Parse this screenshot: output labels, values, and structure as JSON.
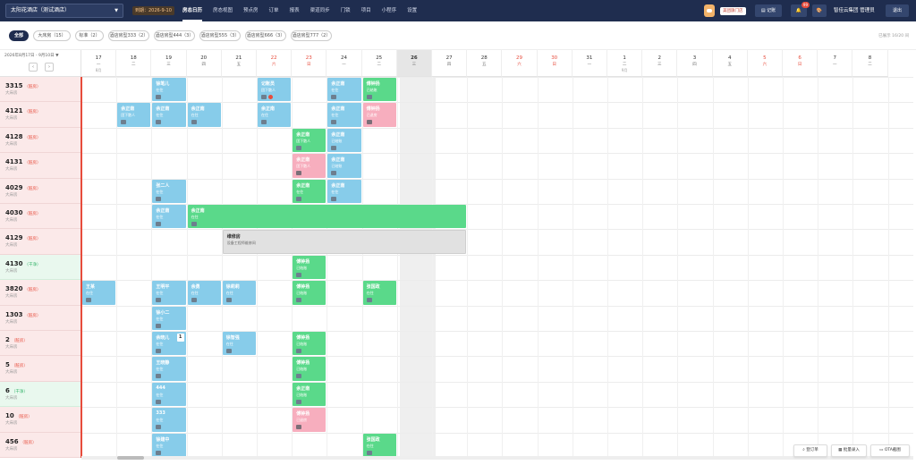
{
  "topbar": {
    "hotel": "太阳花酒店（测试酒店）",
    "expire": "到期：2026-9-10",
    "nav": [
      "房态日历",
      "房态视图",
      "预点房",
      "订单",
      "报表",
      "渠道同步",
      "门锁",
      "项目",
      "小程序",
      "设置"
    ],
    "store_label": "美团旗门店",
    "note_label": "记账",
    "bell_badge": "99",
    "user": "智佳云集团 管理员",
    "logout": "退出"
  },
  "filters": [
    "全部",
    "大床房（15）",
    "标准（2）",
    "酒店房型333（2）",
    "酒店房型444（3）",
    "酒店房型555（3）",
    "酒店房型666（3）",
    "酒店房型777（2）"
  ],
  "shown_count": "已展示 16/20 间",
  "date_range": "2026年8月17日 - 9月10日",
  "days": [
    {
      "d": "17",
      "w": "一",
      "m": "8月"
    },
    {
      "d": "18",
      "w": "二"
    },
    {
      "d": "19",
      "w": "三"
    },
    {
      "d": "20",
      "w": "四"
    },
    {
      "d": "21",
      "w": "五"
    },
    {
      "d": "22",
      "w": "六",
      "we": 1
    },
    {
      "d": "23",
      "w": "日",
      "we": 1
    },
    {
      "d": "24",
      "w": "一"
    },
    {
      "d": "25",
      "w": "二"
    },
    {
      "d": "26",
      "w": "三",
      "today": 1
    },
    {
      "d": "27",
      "w": "四"
    },
    {
      "d": "28",
      "w": "五"
    },
    {
      "d": "29",
      "w": "六",
      "we": 1
    },
    {
      "d": "30",
      "w": "日",
      "we": 1
    },
    {
      "d": "31",
      "w": "一"
    },
    {
      "d": "1",
      "w": "二",
      "m": "9月"
    },
    {
      "d": "2",
      "w": "三"
    },
    {
      "d": "3",
      "w": "四"
    },
    {
      "d": "4",
      "w": "五"
    },
    {
      "d": "5",
      "w": "六",
      "we": 1
    },
    {
      "d": "6",
      "w": "日",
      "we": 1
    },
    {
      "d": "7",
      "w": "一"
    },
    {
      "d": "8",
      "w": "二"
    }
  ],
  "rooms": [
    {
      "no": "3315",
      "status": "（脏房）",
      "type": "大床房"
    },
    {
      "no": "4121",
      "status": "（脏房）",
      "type": "大床房"
    },
    {
      "no": "4128",
      "status": "（脏房）",
      "type": "大床房"
    },
    {
      "no": "4131",
      "status": "（脏房）",
      "type": "大床房"
    },
    {
      "no": "4029",
      "status": "（脏房）",
      "type": "大床房"
    },
    {
      "no": "4030",
      "status": "（脏房）",
      "type": "大床房"
    },
    {
      "no": "4129",
      "status": "（脏房）",
      "type": "大床房"
    },
    {
      "no": "4130",
      "status": "（干净）",
      "type": "大床房",
      "free": 1
    },
    {
      "no": "3820",
      "status": "（脏房）",
      "type": "大床房"
    },
    {
      "no": "1303",
      "status": "（脏房）",
      "type": "大床房"
    },
    {
      "no": "2",
      "status": "（脏房）",
      "type": "大床房"
    },
    {
      "no": "5",
      "status": "（脏房）",
      "type": "大床房"
    },
    {
      "no": "6",
      "status": "（干净）",
      "type": "大床房",
      "free": 1
    },
    {
      "no": "10",
      "status": "（脏房）",
      "type": "大床房"
    },
    {
      "no": "456",
      "status": "（脏房）",
      "type": "大床房"
    }
  ],
  "bookings": [
    {
      "r": 0,
      "c": 2,
      "s": 1,
      "color": "blue",
      "name": "徐笔儿",
      "sub": "在住"
    },
    {
      "r": 0,
      "c": 5,
      "s": 1,
      "color": "blue",
      "name": "记账员",
      "sub": "团下散人",
      "flag": 1
    },
    {
      "r": 0,
      "c": 7,
      "s": 1,
      "color": "blue",
      "name": "余正南",
      "sub": "在住"
    },
    {
      "r": 0,
      "c": 8,
      "s": 1,
      "color": "green",
      "name": "傅钟扬",
      "sub": "已结账"
    },
    {
      "r": 1,
      "c": 1,
      "s": 1,
      "color": "blue",
      "name": "余正南",
      "sub": "团下散人"
    },
    {
      "r": 1,
      "c": 2,
      "s": 1,
      "color": "blue",
      "name": "余正南",
      "sub": "在住"
    },
    {
      "r": 1,
      "c": 3,
      "s": 1,
      "color": "blue",
      "name": "余正南",
      "sub": "在住"
    },
    {
      "r": 1,
      "c": 5,
      "s": 1,
      "color": "blue",
      "name": "余正南",
      "sub": "在住"
    },
    {
      "r": 1,
      "c": 7,
      "s": 1,
      "color": "blue",
      "name": "余正南",
      "sub": "在住"
    },
    {
      "r": 1,
      "c": 8,
      "s": 1,
      "color": "pink",
      "name": "傅钟扬",
      "sub": "已退房"
    },
    {
      "r": 2,
      "c": 6,
      "s": 1,
      "color": "green",
      "name": "余正南",
      "sub": "团下散人"
    },
    {
      "r": 2,
      "c": 7,
      "s": 1,
      "color": "blue",
      "name": "余正南",
      "sub": "已结账"
    },
    {
      "r": 3,
      "c": 6,
      "s": 1,
      "color": "pink",
      "name": "余正南",
      "sub": "团下散人"
    },
    {
      "r": 3,
      "c": 7,
      "s": 1,
      "color": "blue",
      "name": "余正南",
      "sub": "已结账"
    },
    {
      "r": 4,
      "c": 2,
      "s": 1,
      "color": "blue",
      "name": "张二人",
      "sub": "在住"
    },
    {
      "r": 4,
      "c": 6,
      "s": 1,
      "color": "green",
      "name": "余正南",
      "sub": "在住"
    },
    {
      "r": 4,
      "c": 7,
      "s": 1,
      "color": "blue",
      "name": "余正南",
      "sub": "在住"
    },
    {
      "r": 5,
      "c": 2,
      "s": 1,
      "color": "blue",
      "name": "余正南",
      "sub": "在住"
    },
    {
      "r": 5,
      "c": 3,
      "s": 8,
      "color": "green",
      "name": "余正南",
      "sub": "在住"
    },
    {
      "r": 6,
      "c": 4,
      "s": 7,
      "color": "gray",
      "name": "维修房",
      "sub": "设备工程师维修间"
    },
    {
      "r": 7,
      "c": 6,
      "s": 1,
      "color": "green",
      "name": "傅钟扬",
      "sub": "已结账"
    },
    {
      "r": 8,
      "c": 0,
      "s": 1,
      "color": "blue",
      "name": "王某",
      "sub": "在住"
    },
    {
      "r": 8,
      "c": 2,
      "s": 1,
      "color": "blue",
      "name": "王明平",
      "sub": "在住"
    },
    {
      "r": 8,
      "c": 3,
      "s": 1,
      "color": "blue",
      "name": "余勇",
      "sub": "在住"
    },
    {
      "r": 8,
      "c": 4,
      "s": 1,
      "color": "blue",
      "name": "徐莉莉",
      "sub": "在住"
    },
    {
      "r": 8,
      "c": 6,
      "s": 1,
      "color": "green",
      "name": "傅钟扬",
      "sub": "已结账"
    },
    {
      "r": 8,
      "c": 8,
      "s": 1,
      "color": "green",
      "name": "张国政",
      "sub": "在住"
    },
    {
      "r": 9,
      "c": 2,
      "s": 1,
      "color": "blue",
      "name": "徐小二",
      "sub": "在住"
    },
    {
      "r": 10,
      "c": 2,
      "s": 1,
      "color": "blue",
      "name": "余晓儿",
      "sub": "在住",
      "count": "1"
    },
    {
      "r": 10,
      "c": 4,
      "s": 1,
      "color": "blue",
      "name": "徐智强",
      "sub": "在住"
    },
    {
      "r": 10,
      "c": 6,
      "s": 1,
      "color": "green",
      "name": "傅钟扬",
      "sub": "已结账"
    },
    {
      "r": 11,
      "c": 2,
      "s": 1,
      "color": "blue",
      "name": "王晓静",
      "sub": "在住"
    },
    {
      "r": 11,
      "c": 6,
      "s": 1,
      "color": "green",
      "name": "傅钟扬",
      "sub": "已结账"
    },
    {
      "r": 12,
      "c": 2,
      "s": 1,
      "color": "blue",
      "name": "444",
      "sub": "在住"
    },
    {
      "r": 12,
      "c": 6,
      "s": 1,
      "color": "green",
      "name": "余正南",
      "sub": "已结账"
    },
    {
      "r": 13,
      "c": 2,
      "s": 1,
      "color": "blue",
      "name": "333",
      "sub": "在住"
    },
    {
      "r": 13,
      "c": 6,
      "s": 1,
      "color": "pink",
      "name": "傅钟扬",
      "sub": "已退房"
    },
    {
      "r": 14,
      "c": 2,
      "s": 1,
      "color": "blue",
      "name": "徐建中",
      "sub": "在住"
    },
    {
      "r": 14,
      "c": 8,
      "s": 1,
      "color": "green",
      "name": "张国政",
      "sub": "在住"
    }
  ],
  "float_buttons": [
    "登订单",
    "批量录入",
    "OTA截图"
  ],
  "colors": {
    "nav_bg": "#1f2d4f",
    "blue": "#87ccea",
    "green": "#5ad98a",
    "pink": "#f7aebe",
    "dirty": "#fbe9e9",
    "clean": "#e9f8ee"
  }
}
